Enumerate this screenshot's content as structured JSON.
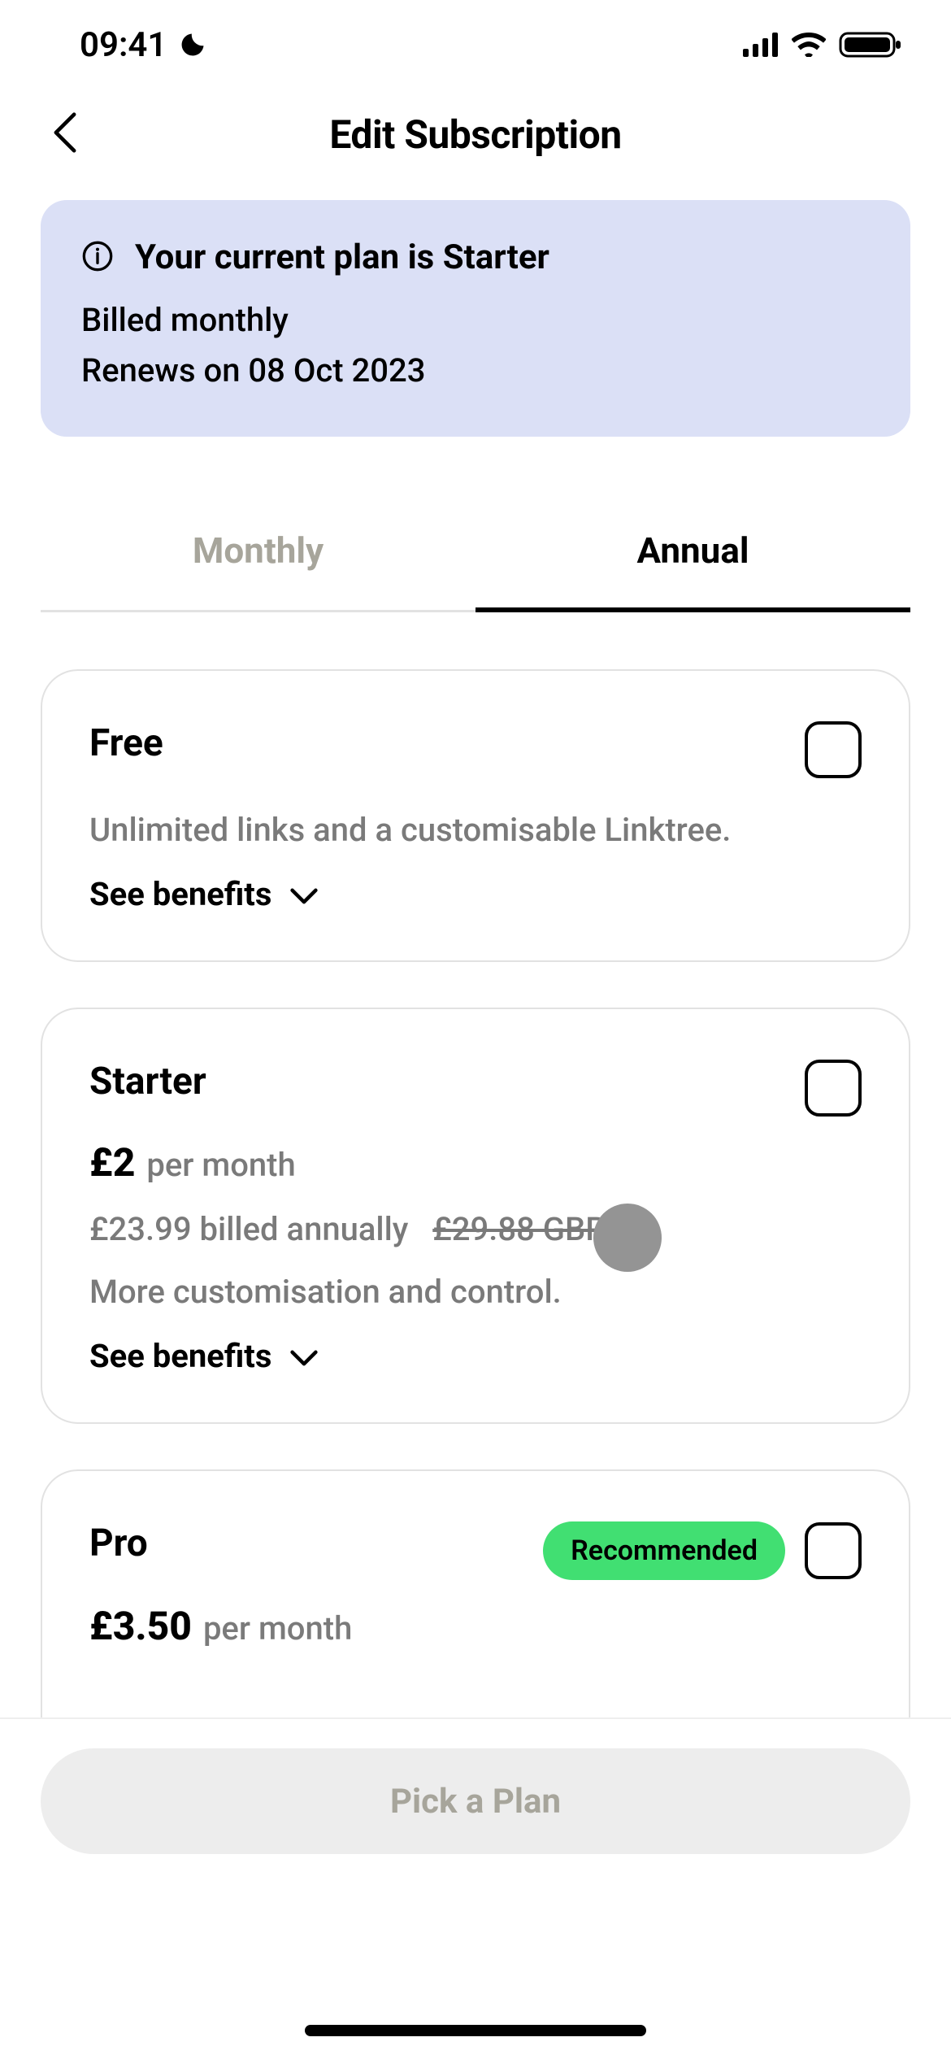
{
  "status": {
    "time": "09:41"
  },
  "nav": {
    "title": "Edit Subscription"
  },
  "banner": {
    "title": "Your current plan is Starter",
    "line1": "Billed monthly",
    "line2": "Renews on 08 Oct 2023"
  },
  "tabs": {
    "monthly": "Monthly",
    "annual": "Annual",
    "active": "annual"
  },
  "plans": [
    {
      "name": "Free",
      "desc": "Unlimited links and a customisable Linktree.",
      "benefits_label": "See benefits"
    },
    {
      "name": "Starter",
      "price": "£2",
      "price_suffix": "per month",
      "billing": "£23.99 billed annually",
      "billing_strike": "£29.88 GBP",
      "desc": "More customisation and control.",
      "benefits_label": "See benefits"
    },
    {
      "name": "Pro",
      "badge": "Recommended",
      "price": "£3.50",
      "price_suffix": "per month"
    }
  ],
  "cta": {
    "label": "Pick a Plan"
  }
}
